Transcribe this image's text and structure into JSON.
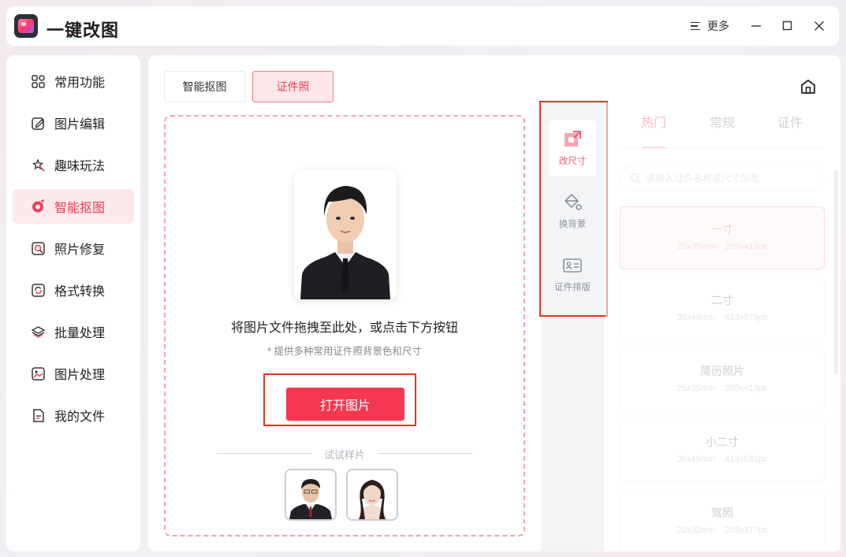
{
  "app": {
    "title": "一键改图"
  },
  "titlebar": {
    "more_label": "更多"
  },
  "sidebar": {
    "items": [
      {
        "label": "常用功能",
        "icon": "grid-icon"
      },
      {
        "label": "图片编辑",
        "icon": "edit-icon"
      },
      {
        "label": "趣味玩法",
        "icon": "magic-wand-icon"
      },
      {
        "label": "智能抠图",
        "icon": "cutout-icon"
      },
      {
        "label": "照片修复",
        "icon": "repair-icon"
      },
      {
        "label": "格式转换",
        "icon": "convert-icon"
      },
      {
        "label": "批量处理",
        "icon": "layers-icon"
      },
      {
        "label": "图片处理",
        "icon": "image-icon"
      },
      {
        "label": "我的文件",
        "icon": "file-icon"
      }
    ],
    "active_index": 3
  },
  "tabs": [
    {
      "label": "智能抠图",
      "active": false
    },
    {
      "label": "证件照",
      "active": true
    }
  ],
  "dropzone": {
    "title": "将图片文件拖拽至此处，或点击下方按钮",
    "subtitle": "* 提供多种常用证件照背景色和尺寸",
    "open_button": "打开图片",
    "samples_label": "试试样片"
  },
  "tools": [
    {
      "label": "改尺寸",
      "icon": "resize-icon",
      "active": true
    },
    {
      "label": "换背景",
      "icon": "paint-bucket-icon",
      "active": false
    },
    {
      "label": "证件排版",
      "icon": "id-card-icon",
      "active": false
    }
  ],
  "size_panel": {
    "categories": [
      {
        "label": "热门",
        "active": true
      },
      {
        "label": "常规",
        "active": false
      },
      {
        "label": "证件",
        "active": false
      }
    ],
    "search_placeholder": "请输入证件名称或尺寸信息",
    "sizes": [
      {
        "name": "一寸",
        "mm": "25x35mm",
        "px": "295x413px",
        "active": true
      },
      {
        "name": "二寸",
        "mm": "35x49mm",
        "px": "413x579px",
        "active": false
      },
      {
        "name": "简历照片",
        "mm": "25x35mm",
        "px": "295x413px",
        "active": false
      },
      {
        "name": "小二寸",
        "mm": "35x45mm",
        "px": "413x531px",
        "active": false
      },
      {
        "name": "驾照",
        "mm": "22x32mm",
        "px": "259x377px",
        "active": false
      }
    ]
  },
  "colors": {
    "accent": "#f4384f",
    "highlight_frame": "#e8321f",
    "active_bg": "#fde9ec"
  }
}
